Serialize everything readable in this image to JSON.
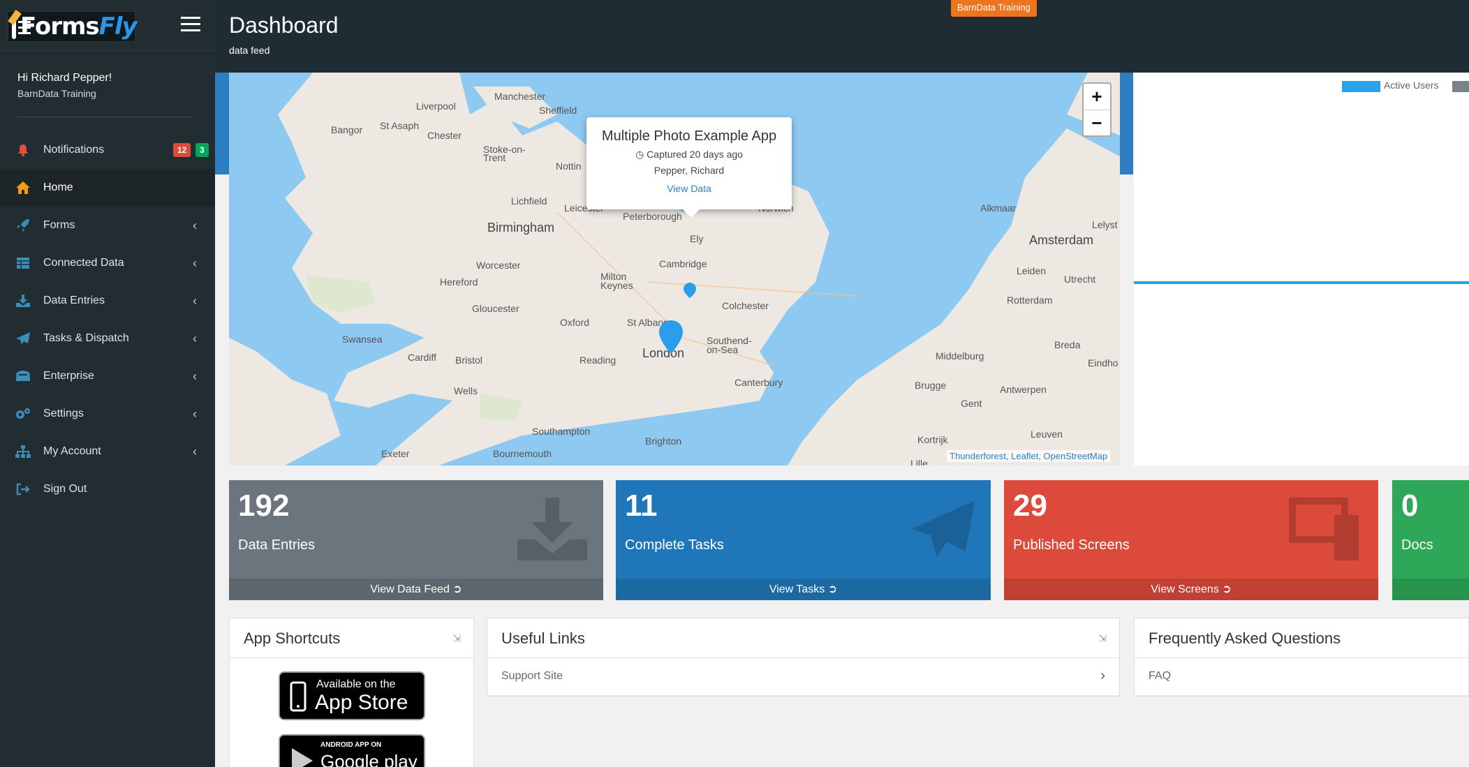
{
  "brand": {
    "logo_forms": "Forms",
    "logo_fly": "Fly"
  },
  "user": {
    "greeting": "Hi Richard Pepper!",
    "org": "BarnData Training"
  },
  "menu": [
    {
      "label": "Notifications",
      "icon": "bell-icon",
      "badges": [
        "12",
        "3"
      ]
    },
    {
      "label": "Home",
      "icon": "home-icon",
      "active": true
    },
    {
      "label": "Forms",
      "icon": "rocket-icon"
    },
    {
      "label": "Connected Data",
      "icon": "table-icon"
    },
    {
      "label": "Data Entries",
      "icon": "download-icon"
    },
    {
      "label": "Tasks & Dispatch",
      "icon": "paper-plane-icon"
    },
    {
      "label": "Enterprise",
      "icon": "building-icon"
    },
    {
      "label": "Settings",
      "icon": "gears-icon"
    },
    {
      "label": "My Account",
      "icon": "sitemap-icon"
    },
    {
      "label": "Sign Out",
      "icon": "sign-out-icon"
    }
  ],
  "header": {
    "title": "Dashboard",
    "subtitle": "data feed",
    "env_badge": "BarnData Training"
  },
  "map": {
    "labels": [
      "Manchester",
      "Liverpool",
      "Sheffield",
      "Bangor",
      "St Asaph",
      "Chester",
      "Stoke-on-Trent",
      "Nottin",
      "Lichfield",
      "Leicester",
      "Peterborough",
      "Norwich",
      "Birmingham",
      "Ely",
      "Cambridge",
      "Worcester",
      "Hereford",
      "Milton Keynes",
      "Gloucester",
      "Oxford",
      "St Albans",
      "Colchester",
      "Swansea",
      "Cardiff",
      "Bristol",
      "Reading",
      "London",
      "Southend-on-Sea",
      "Wells",
      "Canterbury",
      "Southampton",
      "Brighton",
      "Exeter",
      "Bournemouth",
      "Alkmaar",
      "Lelyst",
      "Amsterdam",
      "Leiden",
      "Utrecht",
      "Rotterdam",
      "Breda",
      "Middelburg",
      "Eindho",
      "Brugge",
      "Antwerpen",
      "Gent",
      "Leuven",
      "Kortrijk",
      "Lille"
    ],
    "popup": {
      "title": "Multiple Photo Example App",
      "captured": "Captured 20 days ago",
      "person": "Pepper, Richard",
      "link": "View Data"
    },
    "attribution": "Thunderforest, Leaflet, OpenStreetMap",
    "zoom_in": "+",
    "zoom_out": "−"
  },
  "chart": {
    "legend": "Active Users",
    "series_color": "#29a3ea"
  },
  "tiles": [
    {
      "value": "192",
      "label": "Data Entries",
      "footer": "View Data Feed",
      "color": "#6c757d"
    },
    {
      "value": "11",
      "label": "Complete Tasks",
      "footer": "View Tasks",
      "color": "#1f77b9"
    },
    {
      "value": "29",
      "label": "Published Screens",
      "footer": "View Screens",
      "color": "#db4a3b"
    },
    {
      "value": "0",
      "label": "Docs",
      "footer": "",
      "color": "#2ea858"
    }
  ],
  "panels": {
    "shortcuts": {
      "title": "App Shortcuts",
      "appstore_top": "Available on the",
      "appstore_main": "App Store",
      "google_top": "ANDROID APP ON",
      "google_main": "Google play"
    },
    "links": {
      "title": "Useful Links",
      "items": [
        "Support Site"
      ]
    },
    "faq": {
      "title": "Frequently Asked Questions",
      "items": [
        "FAQ"
      ]
    }
  }
}
